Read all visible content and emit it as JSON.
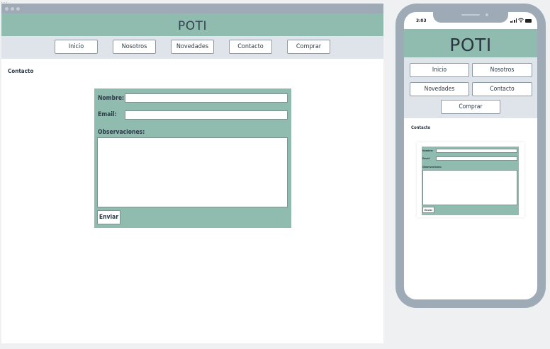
{
  "top_marker": "...",
  "brand": "POTI",
  "nav": [
    "Inicio",
    "Nosotros",
    "Novedades",
    "Contacto",
    "Comprar"
  ],
  "page_title": "Contacto",
  "form": {
    "name_label": "Nombre:",
    "email_label": "Email:",
    "notes_label": "Observaciones:",
    "submit_label": "Enviar",
    "name_value": "",
    "email_value": "",
    "notes_value": ""
  },
  "phone": {
    "time": "3:03",
    "status_icons": [
      "signal-icon",
      "wifi-icon",
      "battery-icon"
    ]
  },
  "colors": {
    "header": "#90bcb0",
    "nav_bar": "#dfe4ea",
    "frame": "#9eaab6",
    "background": "#eef0f2"
  }
}
